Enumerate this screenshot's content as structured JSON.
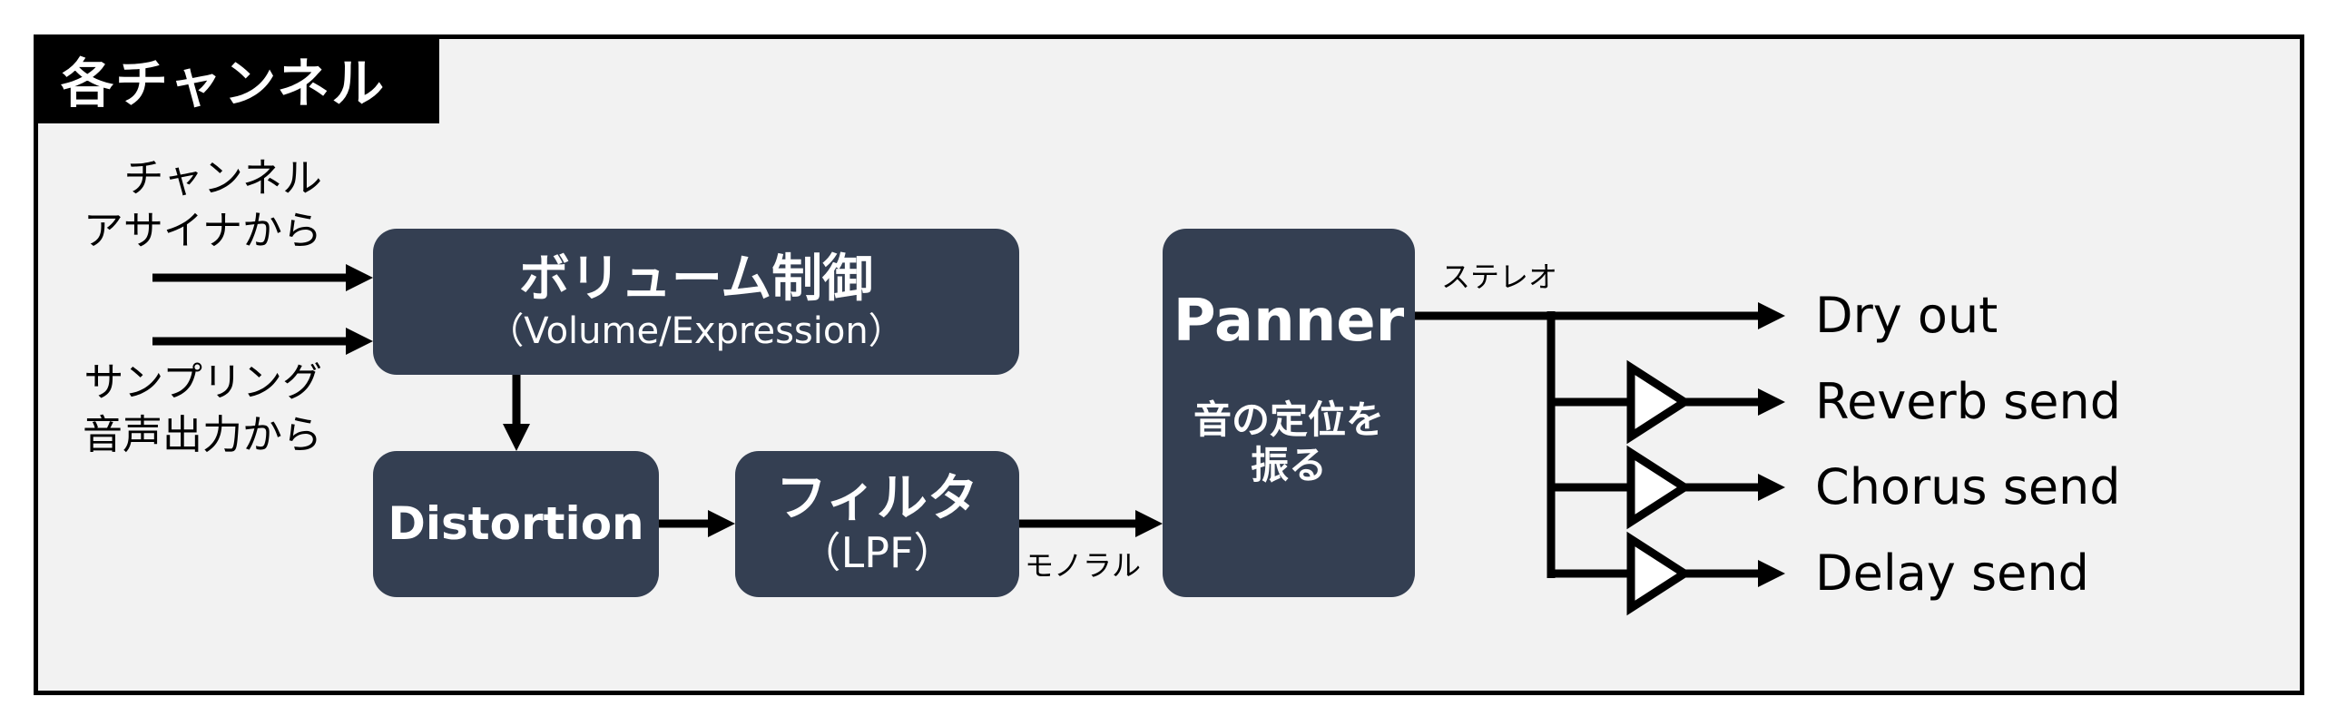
{
  "title": "各チャンネル",
  "inputs": [
    {
      "lines": [
        "チャンネル",
        "アサイナから"
      ]
    },
    {
      "lines": [
        "サンプリング",
        "音声出力から"
      ]
    }
  ],
  "blocks": {
    "volume": {
      "main": "ボリューム制御",
      "sub": "（Volume/Expression）"
    },
    "distortion": {
      "main": "Distortion"
    },
    "filter": {
      "main": "フィルタ",
      "sub": "（LPF）"
    },
    "panner": {
      "main": "Panner",
      "sub_lines": [
        "音の定位を",
        "振る"
      ]
    }
  },
  "connection_labels": {
    "mono": "モノラル",
    "stereo": "ステレオ"
  },
  "outputs": [
    {
      "label": "Dry out",
      "has_gain": false
    },
    {
      "label": "Reverb send",
      "has_gain": true
    },
    {
      "label": "Chorus send",
      "has_gain": true
    },
    {
      "label": "Delay send",
      "has_gain": true
    }
  ],
  "colors": {
    "block": "#343f52",
    "background": "#f2f2f2",
    "line": "#000000"
  }
}
